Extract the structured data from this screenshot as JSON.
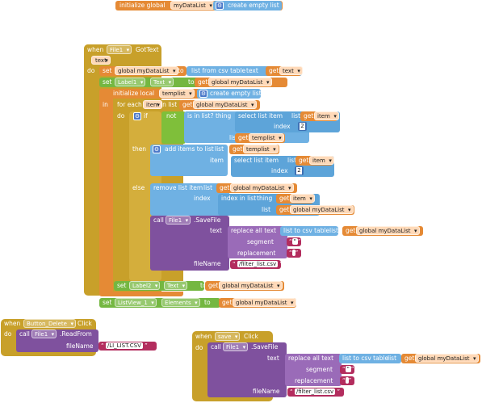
{
  "global": {
    "init_label": "initialize global",
    "var_name": "myDataList",
    "to": "to",
    "create_empty": "create empty list"
  },
  "event": {
    "when": "when",
    "component": "File1",
    "event_name": "GotText",
    "param": "text",
    "do": "do",
    "set1": {
      "set": "set",
      "var": "global myDataList",
      "to": "to",
      "list_from_csv": "list from csv table",
      "text_label": "text",
      "get": "get",
      "get_var": "text"
    },
    "set2": {
      "set": "set",
      "comp": "Label1",
      "prop": "Text",
      "to": "to",
      "get": "get",
      "get_var": "global myDataList"
    },
    "local": {
      "init_local": "initialize local",
      "var": "templist",
      "to": "to",
      "create_empty": "create empty list",
      "in": "in"
    },
    "foreach": {
      "for_each": "for each",
      "item": "item",
      "in_list": "in list",
      "get": "get",
      "get_var": "global myDataList",
      "do": "do"
    },
    "ifblock": {
      "if": "if",
      "not": "not",
      "is_in_list": "is in list? thing",
      "select_list_item": "select list item",
      "list": "list",
      "get": "get",
      "item_var": "item",
      "index": "index",
      "index_val": "2",
      "list2": "list",
      "templist": "templist"
    },
    "then": {
      "then": "then",
      "add_items": "add items to list",
      "list": "list",
      "get": "get",
      "templist": "templist",
      "item": "item",
      "select_list_item": "select list item",
      "list2": "list",
      "item_var": "item",
      "index": "index",
      "index_val": "2"
    },
    "else": {
      "else": "else",
      "remove_list_item": "remove list item",
      "list": "list",
      "get": "get",
      "var": "global myDataList",
      "index": "index",
      "index_in_list": "index in list",
      "thing": "thing",
      "item_var": "item",
      "list2": "list",
      "var2": "global myDataList"
    },
    "call": {
      "call": "call",
      "comp": "File1",
      "method": ".SaveFile",
      "text": "text",
      "replace_all": "replace all text",
      "list_to_csv": "list to csv table",
      "list": "list",
      "get": "get",
      "var": "global myDataList",
      "segment": "segment",
      "seg_val": "\"",
      "replacement": "replacement",
      "rep_val": "",
      "fileName": "fileName",
      "filename_val": "/filter_list.csv"
    },
    "set3": {
      "set": "set",
      "comp": "Label2",
      "prop": "Text",
      "to": "to",
      "get": "get",
      "var": "global myDataList"
    },
    "set4": {
      "set": "set",
      "comp": "ListView_1",
      "prop": "Elements",
      "to": "to",
      "get": "get",
      "var": "global myDataList"
    }
  },
  "delete_event": {
    "when": "when",
    "component": "Button_Delete",
    "event_name": "Click",
    "do": "do",
    "call": "call",
    "comp": "File1",
    "method": ".ReadFrom",
    "fileName": "fileName",
    "filename_val": "/LI_LIST.CSV"
  },
  "save_event": {
    "when": "when",
    "component": "save",
    "event_name": "Click",
    "do": "do",
    "call": "call",
    "comp": "File1",
    "method": ".SaveFile",
    "text": "text",
    "replace_all": "replace all text",
    "list_to_csv": "list to csv table",
    "list": "list",
    "get": "get",
    "var": "global myDataList",
    "segment": "segment",
    "seg_val": "\"",
    "replacement": "replacement",
    "rep_val": "",
    "fileName": "fileName",
    "filename_val": "/filter_list.csv"
  },
  "colors": {
    "control": "#c8a02a",
    "list": "#6fb1e3",
    "variable": "#e58a35",
    "component": "#74b741",
    "call": "#7f519e",
    "logic": "#7fbf3a",
    "text": "#b32d5e",
    "math": "#3f71b5"
  },
  "icons": {
    "mutator": "gear-icon",
    "dropdown": "chevron-down-icon"
  }
}
